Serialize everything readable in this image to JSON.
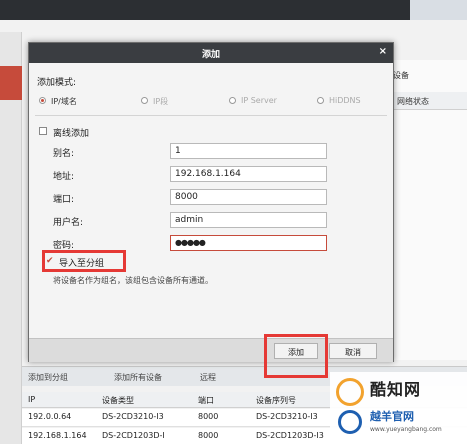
{
  "dialog": {
    "title": "添加",
    "close_glyph": "×",
    "add_mode_label": "添加模式:",
    "modes": [
      {
        "label": "IP/域名",
        "selected": true
      },
      {
        "label": "IP段",
        "selected": false
      },
      {
        "label": "IP Server",
        "selected": false
      },
      {
        "label": "HiDDNS",
        "selected": false
      }
    ],
    "offline_label": "离线添加",
    "fields": {
      "alias": {
        "label": "别名:",
        "value": "1"
      },
      "address": {
        "label": "地址:",
        "value": "192.168.1.164"
      },
      "port": {
        "label": "端口:",
        "value": "8000"
      },
      "username": {
        "label": "用户名:",
        "value": "admin"
      },
      "password": {
        "label": "密码:",
        "value": "●●●●●"
      }
    },
    "import_group_label": "导入至分组",
    "import_group_checked": true,
    "import_group_hint": "将设备名作为组名，该组包含设备所有通道。",
    "add_button": "添加",
    "cancel_button": "取消"
  },
  "background": {
    "right_button": "设备",
    "right_header": "网络状态",
    "toolbar": [
      "添加到分组",
      "添加所有设备",
      "远程"
    ],
    "table_headers": [
      "IP",
      "设备类型",
      "端口",
      "设备序列号"
    ],
    "rows": [
      [
        "192.0.0.64",
        "DS-2CD3210-I3",
        "8000",
        "DS-2CD3210-I3"
      ],
      [
        "192.168.1.164",
        "DS-2CD1203D-I",
        "8000",
        "DS-2CD1203D-I3"
      ]
    ]
  },
  "watermark": {
    "brand_cn": "酷知网",
    "brand_cn_2": "越羊官网",
    "url": "www.yueyangbang.com"
  },
  "colors": {
    "accent": "#c64b3b",
    "highlight": "#e53935",
    "titlebar": "#3a3d41"
  }
}
